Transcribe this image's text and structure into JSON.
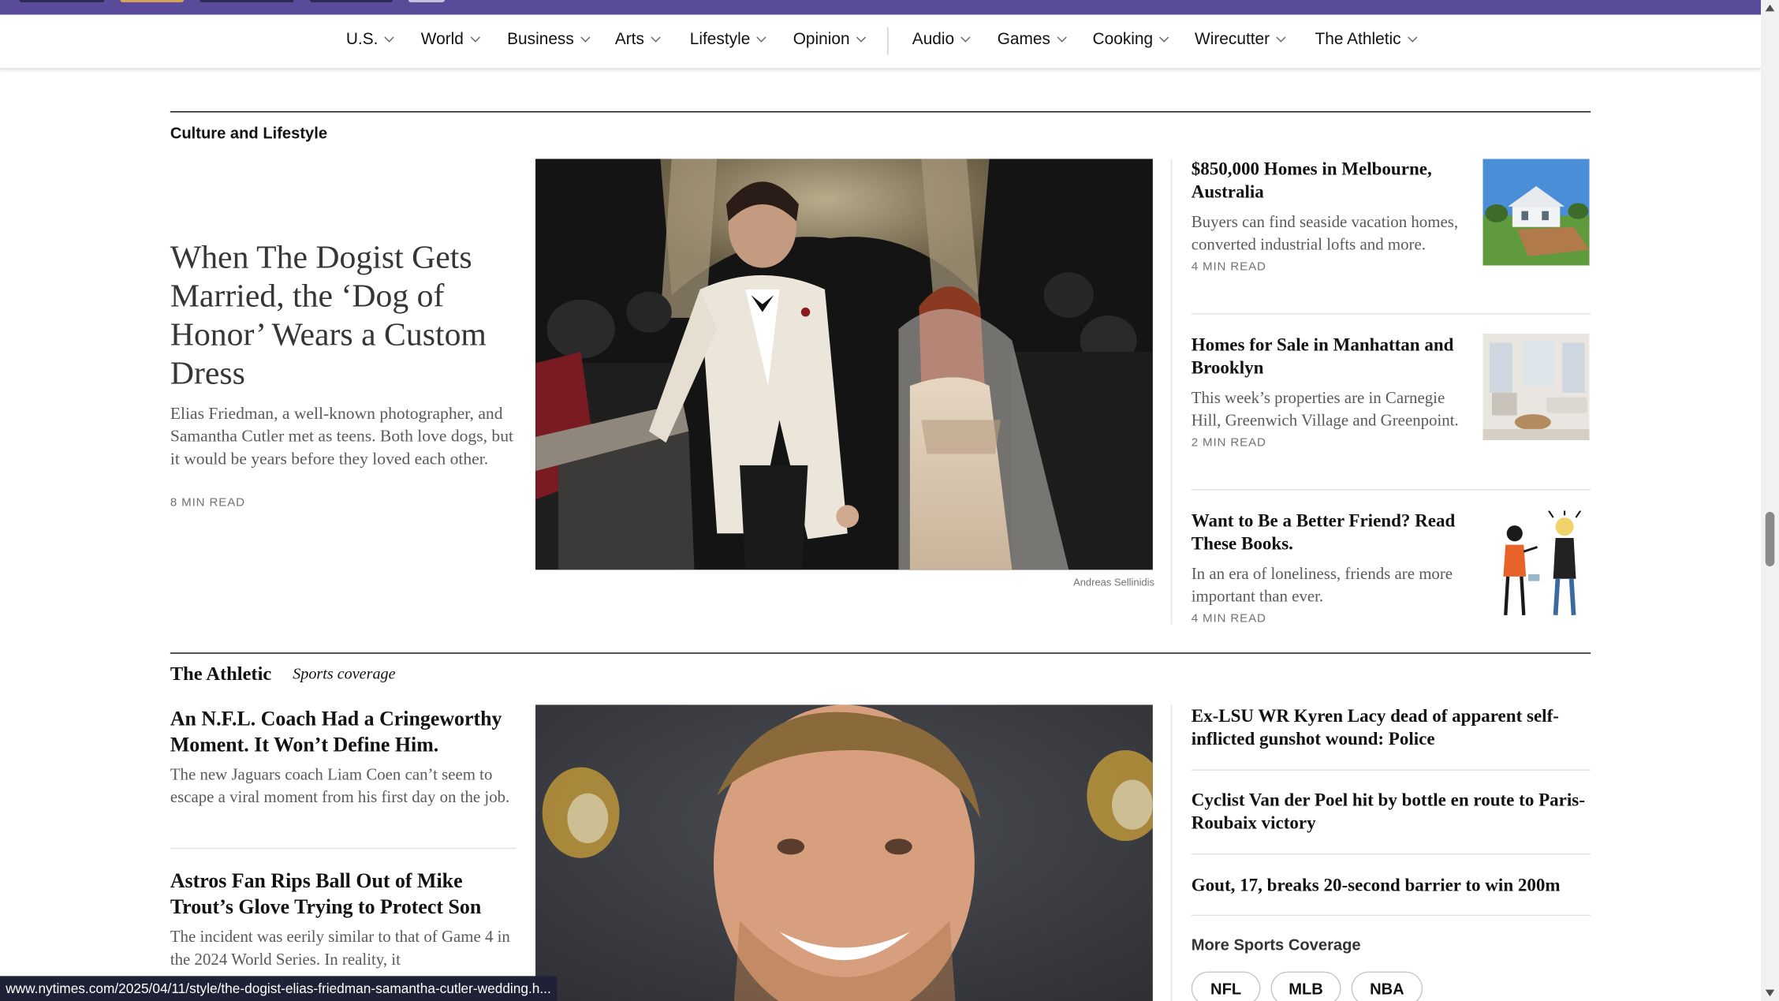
{
  "nav": {
    "items": [
      {
        "label": "U.S."
      },
      {
        "label": "World"
      },
      {
        "label": "Business"
      },
      {
        "label": "Arts"
      },
      {
        "label": "Lifestyle"
      },
      {
        "label": "Opinion"
      },
      {
        "label": "Audio"
      },
      {
        "label": "Games"
      },
      {
        "label": "Cooking"
      },
      {
        "label": "Wirecutter"
      },
      {
        "label": "The Athletic"
      }
    ]
  },
  "culture": {
    "section_label": "Culture and Lifestyle",
    "lead": {
      "headline": "When The Dogist Gets Married, the ‘Dog of Honor’ Wears a Custom Dress",
      "summary": "Elias Friedman, a well-known photographer, and Samantha Cutler met as teens. Both love dogs, but it would be years before they loved each other.",
      "read_time": "8 MIN READ",
      "photo_credit": "Andreas Sellinidis"
    },
    "side": [
      {
        "title": "$850,000 Homes in Melbourne, Australia",
        "summary": "Buyers can find seaside vacation homes, converted industrial lofts and more.",
        "read_time": "4 MIN READ"
      },
      {
        "title": "Homes for Sale in Manhattan and Brooklyn",
        "summary": "This week’s properties are in Carnegie Hill, Greenwich Village and Greenpoint.",
        "read_time": "2 MIN READ"
      },
      {
        "title": "Want to Be a Better Friend? Read These Books.",
        "summary": "In an era of loneliness, friends are more important than ever.",
        "read_time": "4 MIN READ"
      }
    ]
  },
  "athletic": {
    "brand": "The Athletic",
    "subtitle": "Sports coverage",
    "stories": [
      {
        "headline": "An N.F.L. Coach Had a Cringeworthy Moment. It Won’t Define Him.",
        "summary": "The new Jaguars coach Liam Coen can’t seem to escape a viral moment from his first day on the job."
      },
      {
        "headline": "Astros Fan Rips Ball Out of Mike Trout’s Glove Trying to Protect Son",
        "summary": "The incident was eerily similar to that of Game 4 in the 2024 World Series. In reality, it"
      }
    ],
    "side": [
      {
        "title": "Ex-LSU WR Kyren Lacy dead of apparent self-inflicted gunshot wound: Police"
      },
      {
        "title": "Cyclist Van der Poel hit by bottle en route to Paris-Roubaix victory"
      },
      {
        "title": "Gout, 17, breaks 20-second barrier to win 200m"
      }
    ],
    "more_label": "More Sports Coverage",
    "pills": [
      "NFL",
      "MLB",
      "NBA"
    ]
  },
  "status_bar": {
    "url": "www.nytimes.com/2025/04/11/style/the-dogist-elias-friedman-samantha-cutler-wedding.h..."
  },
  "colors": {
    "topbar": "#5a4a9a",
    "text": "#121212",
    "summary": "#5a5a5a"
  }
}
